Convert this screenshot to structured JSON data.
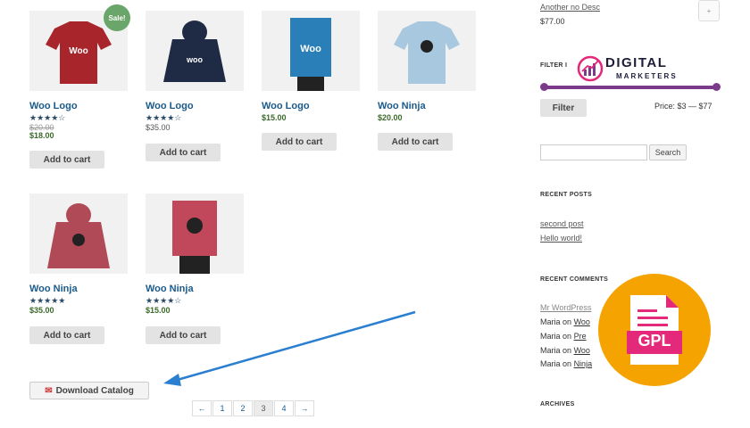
{
  "products": [
    {
      "name": "Woo Logo",
      "stars": "★★★★☆",
      "price_old": "$20.00",
      "price": "$18.00",
      "button": "Add to cart",
      "sale": "Sale!",
      "thumb_text": "Woo"
    },
    {
      "name": "Woo Logo",
      "stars": "★★★★☆",
      "price": "$35.00",
      "button": "Add to cart",
      "thumb_text": "woo"
    },
    {
      "name": "Woo Logo",
      "price": "$15.00",
      "button": "Add to cart",
      "thumb_text": "Woo"
    },
    {
      "name": "Woo Ninja",
      "price": "$20.00",
      "button": "Add to cart"
    },
    {
      "name": "Woo Ninja",
      "stars": "★★★★★",
      "price": "$35.00",
      "button": "Add to cart"
    },
    {
      "name": "Woo Ninja",
      "stars": "★★★★☆",
      "price": "$15.00",
      "button": "Add to cart"
    }
  ],
  "download_catalog": "Download Catalog",
  "pagination": [
    "←",
    "1",
    "2",
    "3",
    "4",
    "→"
  ],
  "pagination_current": "3",
  "sidebar": {
    "top_product": "Another no Desc",
    "top_price": "$77.00",
    "filter_heading": "FILTER I",
    "filter_button": "Filter",
    "price_range": "Price: $3 — $77",
    "price_range_min": 3,
    "price_range_max": 77,
    "search_button": "Search",
    "search_placeholder": "",
    "recent_posts_heading": "RECENT POSTS",
    "recent_posts": [
      "second post",
      "Hello world!"
    ],
    "recent_comments_heading": "RECENT COMMENTS",
    "comments": [
      {
        "author": "Mr WordPress",
        "on": "",
        "target": ""
      },
      {
        "author": "Maria",
        "on": "on",
        "target": "Woo"
      },
      {
        "author": "Maria",
        "on": "on",
        "target": "Pre"
      },
      {
        "author": "Maria",
        "on": "on",
        "target": "Woo"
      },
      {
        "author": "Maria",
        "on": "on",
        "target": "Ninja"
      }
    ],
    "archives_heading": "ARCHIVES"
  },
  "watermark": {
    "line1": "DIGITAL",
    "line2": "MARKETERS"
  },
  "gpl_badge": "GPL",
  "colors": {
    "accent": "#1a5a8a",
    "slider": "#7b3a8a",
    "badge": "#f5a300",
    "gpl": "#e4287a",
    "sale": "#6aa56a"
  }
}
